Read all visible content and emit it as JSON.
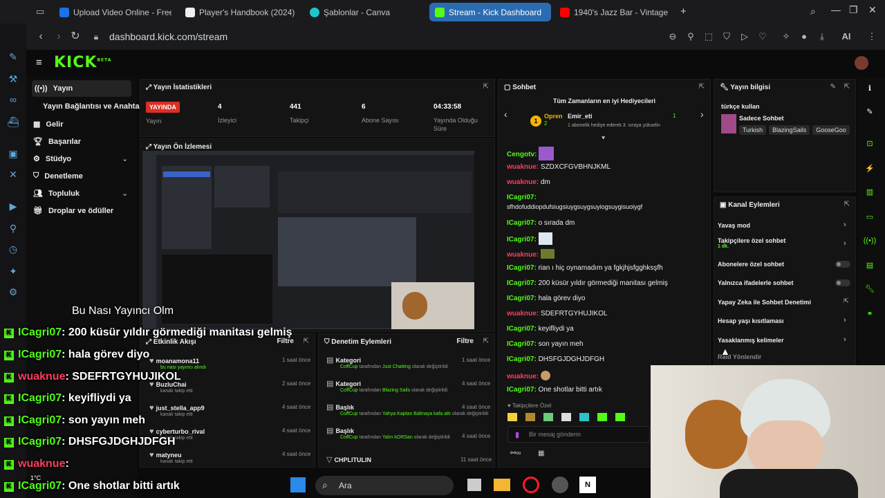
{
  "tabs": [
    {
      "label": "Upload Video Online - Free",
      "color": "#1a73e8"
    },
    {
      "label": "Player's Handbook (2024)",
      "color": "#ffffff"
    },
    {
      "label": "Şablonlar - Canva",
      "color": "#20c4cb"
    },
    {
      "label": "Stream - Kick Dashboard",
      "color": "#53fc18"
    },
    {
      "label": "1940's Jazz Bar - Vintage",
      "color": "#ff0000"
    }
  ],
  "address": {
    "url": "dashboard.kick.com/stream",
    "ai_label": "AI"
  },
  "kick": {
    "logo": "KICK",
    "logo_sup": "BETA"
  },
  "sidebar": {
    "items": [
      {
        "label": "Yayın"
      },
      {
        "label": "Yayın Bağlantısı ve Anahtarı"
      },
      {
        "label": "Gelir"
      },
      {
        "label": "Başarılar"
      },
      {
        "label": "Stüdyo"
      },
      {
        "label": "Denetleme"
      },
      {
        "label": "Topluluk"
      },
      {
        "label": "Droplar ve ödüller"
      }
    ]
  },
  "stats": {
    "title": "Yayın İstatistikleri",
    "live_label": "YAYINDA",
    "items": [
      {
        "value": "",
        "label": "Yayın"
      },
      {
        "value": "4",
        "label": "İzleyici"
      },
      {
        "value": "441",
        "label": "Takipçi"
      },
      {
        "value": "6",
        "label": "Abone Sayısı"
      },
      {
        "value": "04:33:58",
        "label": "Yayında Olduğu Süre"
      }
    ]
  },
  "preview": {
    "title": "Yayın Ön İzlemesi",
    "overlay_caption": "Bu Nası Yayıncı Olm"
  },
  "chat": {
    "title": "Sohbet",
    "top_gifters_title": "Tüm Zamanların en iyi Hediyecileri",
    "gifter_1": "Opren",
    "gifter_1_count": "2",
    "gifter_2": "Emir_eti",
    "gifter_2_count": "1",
    "gifter_note": "1 abonelik hediye ederek 3. sıraya yükselin",
    "messages": [
      {
        "user": "Cengotv:",
        "text": "",
        "emote": true,
        "color": "g"
      },
      {
        "user": "wuaknue:",
        "text": "SZDXCFGVBHNJKML",
        "color": "r"
      },
      {
        "user": "wuaknue:",
        "text": "dm",
        "color": "r"
      },
      {
        "user": "ICagri07:",
        "text": "",
        "color": "g"
      },
      {
        "user": "",
        "text": "sfhdofuddiopdufsiugsiuygsuygsuyiogsuygisuoiygf",
        "color": "g"
      },
      {
        "user": "ICagri07:",
        "text": "o sırada dm",
        "color": "g"
      },
      {
        "user": "ICagri07:",
        "text": "",
        "emote": true,
        "color": "g"
      },
      {
        "user": "wuaknue:",
        "text": "",
        "emote": true,
        "color": "r"
      },
      {
        "user": "ICagri07:",
        "text": "rian ı hiç oynamadım ya fgkjhjsfgghksşfh",
        "color": "g"
      },
      {
        "user": "ICagri07:",
        "text": "200 küsür yıldır görmediği manitası gelmiş",
        "color": "g"
      },
      {
        "user": "ICagri07:",
        "text": "hala görev diyo",
        "color": "g"
      },
      {
        "user": "wuaknue:",
        "text": "SDEFRTGYHUJIKOL",
        "color": "r"
      },
      {
        "user": "ICagri07:",
        "text": "keyifliydi ya",
        "color": "g"
      },
      {
        "user": "ICagri07:",
        "text": "son yayın meh",
        "color": "g"
      },
      {
        "user": "ICagri07:",
        "text": "DHSFGJDGHJDFGH",
        "color": "g"
      },
      {
        "user": "wuaknue:",
        "text": "",
        "emote": true,
        "color": "r"
      },
      {
        "user": "ICagri07:",
        "text": "One shotlar bitti artık",
        "color": "g"
      }
    ],
    "followers_only": "Takipçilere Özel",
    "input_placeholder": "Bir mesaj gönderin"
  },
  "info": {
    "title": "Yayın bilgisi",
    "stream_title": "türkçe kullan",
    "category": "Sadece Sohbet",
    "tags": [
      "Turkish",
      "BlazingSails",
      "GooseGoo"
    ]
  },
  "channel_actions": {
    "title": "Kanal Eylemleri",
    "items": [
      {
        "label": "Yavaş mod",
        "sub": ""
      },
      {
        "label": "Takipçilere özel sohbet",
        "sub": "1 dk."
      },
      {
        "label": "Abonelere özel sohbet",
        "sub": ""
      },
      {
        "label": "Yalnızca ifadelerle sohbet",
        "sub": ""
      },
      {
        "label": "Yapay Zeka ile Sohbet Denetimi",
        "sub": ""
      },
      {
        "label": "Hesap yaşı kısıtlaması",
        "sub": ""
      },
      {
        "label": "Yasaklanmış kelimeler",
        "sub": ""
      },
      {
        "label": "Raid Yönlendir",
        "sub": ""
      }
    ]
  },
  "activity": {
    "title": "Etkinlik Akışı",
    "filter": "Filtre",
    "items": [
      {
        "name": "moanamona11",
        "sub": "bu nası yayıncı alındı",
        "time": "1 saat önce"
      },
      {
        "name": "BuzluChai",
        "sub": "kanalı takip etti",
        "time": "2 saat önce"
      },
      {
        "name": "just_stella_app9",
        "sub": "kanalı takip etti",
        "time": "4 saat önce"
      },
      {
        "name": "cyberturbo_rival",
        "sub": "kanalı takip etti",
        "time": "4 saat önce"
      },
      {
        "name": "matyneu",
        "sub": "kanalı takip etti",
        "time": "4 saat önce"
      }
    ]
  },
  "moderation": {
    "title": "Denetim Eylemleri",
    "filter": "Filtre",
    "items": [
      {
        "type": "Kategori",
        "by": "CoffCup",
        "mid": "tarafından",
        "val": "Just Chatting",
        "end": "olarak değiştirildi",
        "time": "1 saat önce"
      },
      {
        "type": "Kategori",
        "by": "CoffCup",
        "mid": "tarafından",
        "val": "Blazing Sails",
        "end": "olarak değiştirildi",
        "time": "4 saat önce"
      },
      {
        "type": "Başlık",
        "by": "CoffCup",
        "mid": "tarafından",
        "val": "Yahya Kaptan Balinaya kafa attı",
        "end": "olarak değiştirildi",
        "time": "4 saat önce"
      },
      {
        "type": "Başlık",
        "by": "CoffCup",
        "mid": "tarafından",
        "val": "Yalın kORSan",
        "end": "olarak değiştirildi",
        "time": "4 saat önce"
      },
      {
        "type": "CHPLITULIN",
        "by": "",
        "mid": "",
        "val": "",
        "end": "",
        "time": "11 saat önce"
      }
    ]
  },
  "overlay_chat": [
    {
      "user": "ICagri07",
      "text": ": 200 küsür yıldır görmediği manitası gelmiş",
      "color": "g"
    },
    {
      "user": "ICagri07",
      "text": ": hala görev diyo",
      "color": "g"
    },
    {
      "user": "wuaknue",
      "text": ": SDEFRTGYHUJIKOL",
      "color": "r"
    },
    {
      "user": "ICagri07",
      "text": ": keyifliydi ya",
      "color": "g"
    },
    {
      "user": "ICagri07",
      "text": ": son yayın meh",
      "color": "g"
    },
    {
      "user": "ICagri07",
      "text": ": DHSFGJDGHJDFGH",
      "color": "g"
    },
    {
      "user": "wuaknue",
      "text": ": ",
      "color": "r"
    },
    {
      "user": "ICagri07",
      "text": ": One shotlar bitti artık",
      "color": "g"
    }
  ],
  "taskbar": {
    "search": "Ara",
    "weather": "1°C"
  },
  "colors": {
    "kick_green": "#53fc18",
    "live_red": "#d93025",
    "tab_active": "#2b6cb0"
  }
}
